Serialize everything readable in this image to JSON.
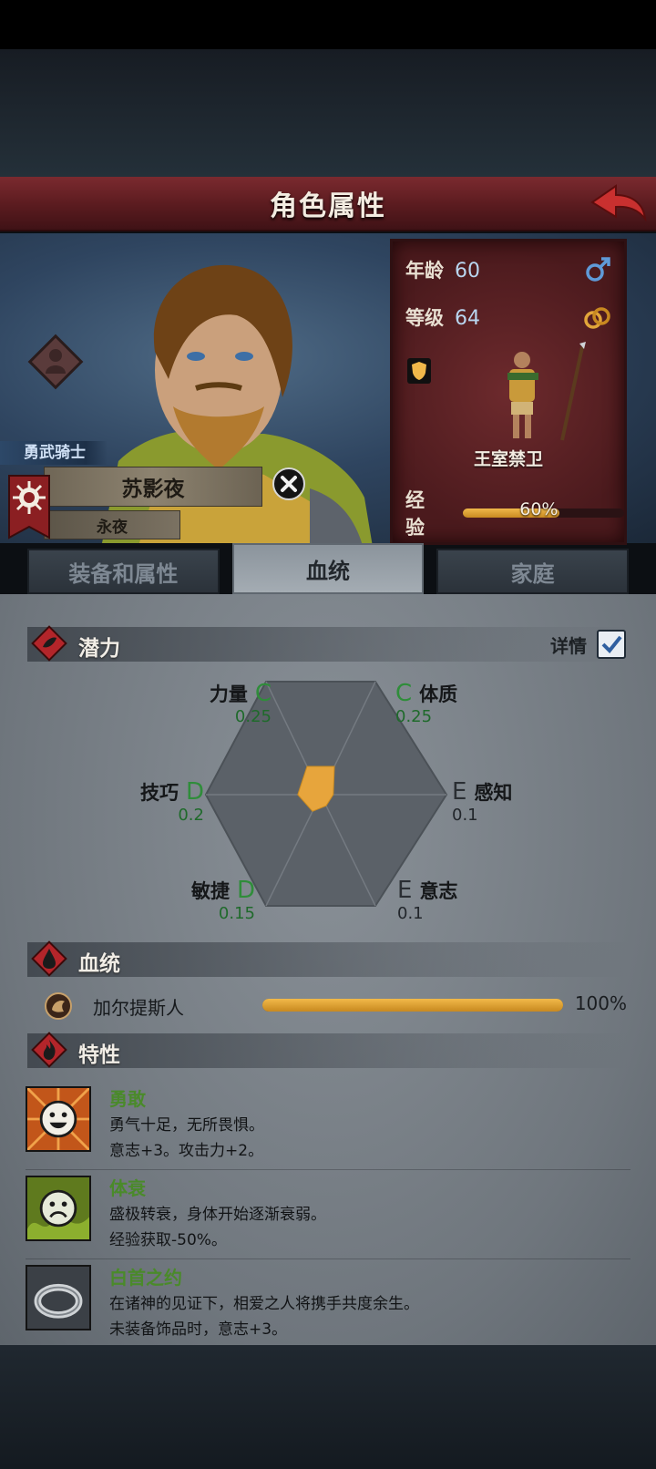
{
  "header": {
    "title": "角色属性"
  },
  "character": {
    "rank": "勇武骑士",
    "name": "苏影夜",
    "title": "永夜",
    "age_label": "年龄",
    "age": "60",
    "level_label": "等级",
    "level": "64",
    "troop": "王室禁卫",
    "exp_label": "经验",
    "exp_percent_text": "60%",
    "exp_fraction": 0.6
  },
  "tabs": [
    {
      "label": "装备和属性",
      "active": false
    },
    {
      "label": "血统",
      "active": true
    },
    {
      "label": "家庭",
      "active": false
    }
  ],
  "potential": {
    "section_title": "潜力",
    "detail_label": "详情",
    "detail_checked": true,
    "stats": [
      {
        "name": "力量",
        "grade": "C",
        "value": "0.25"
      },
      {
        "name": "体质",
        "grade": "C",
        "value": "0.25"
      },
      {
        "name": "感知",
        "grade": "E",
        "value": "0.1"
      },
      {
        "name": "意志",
        "grade": "E",
        "value": "0.1"
      },
      {
        "name": "敏捷",
        "grade": "D",
        "value": "0.15"
      },
      {
        "name": "技巧",
        "grade": "D",
        "value": "0.2"
      }
    ]
  },
  "bloodline": {
    "section_title": "血统",
    "name": "加尔提斯人",
    "percent_text": "100%",
    "fraction": 1.0
  },
  "traits": {
    "section_title": "特性",
    "items": [
      {
        "name": "勇敢",
        "desc": "勇气十足，无所畏惧。",
        "effect": "意志+3。攻击力+2。",
        "icon": "happy-face-icon"
      },
      {
        "name": "体衰",
        "desc": "盛极转衰，身体开始逐渐衰弱。",
        "effect": "经验获取-50%。",
        "icon": "sad-face-icon"
      },
      {
        "name": "白首之约",
        "desc": "在诸神的见证下，相爱之人将携手共度余生。",
        "effect": "未装备饰品时，意志+3。",
        "icon": "ring-icon"
      }
    ]
  },
  "colors": {
    "accent_red": "#5a1b1f",
    "exp_gold": "#e2a63a",
    "grade_green": "#2f8d3a"
  }
}
